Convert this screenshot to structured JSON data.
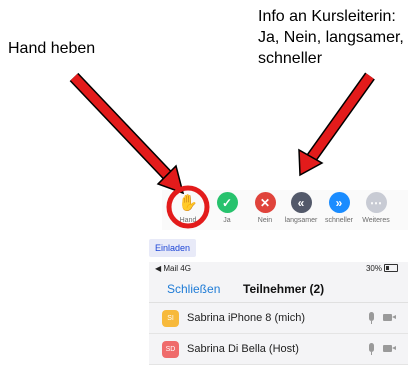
{
  "annotations": {
    "left_label": "Hand heben",
    "right_lines": [
      "Info an Kursleiterin:",
      "Ja, Nein, langsamer,",
      "schneller"
    ]
  },
  "colors": {
    "arrow": "#e31b1b",
    "accent_blue": "#1e7bd6",
    "raise_hand": "#2d8cff",
    "yes_green": "#27c26d",
    "no_red": "#e0433b",
    "slower_grey": "#53596a",
    "faster_blue": "#1a8cff",
    "more_grey": "#c8cbd4"
  },
  "reactions": [
    {
      "icon": "raise-hand-icon",
      "label": "Hand"
    },
    {
      "icon": "check-icon",
      "label": "Ja"
    },
    {
      "icon": "x-icon",
      "label": "Nein"
    },
    {
      "icon": "rewind-icon",
      "label": "langsamer"
    },
    {
      "icon": "fast-forward-icon",
      "label": "schneller"
    },
    {
      "icon": "ellipsis-icon",
      "label": "Weiteres"
    }
  ],
  "invite_label": "Einladen",
  "status_bar": {
    "left": "◀ Mail  4G",
    "right": "30%"
  },
  "nav": {
    "close_label": "Schließen",
    "title": "Teilnehmer (2)"
  },
  "participants": [
    {
      "initials": "SI",
      "name": "Sabrina iPhone 8 (mich)",
      "color": "#f7b93b"
    },
    {
      "initials": "SD",
      "name": "Sabrina Di Bella (Host)",
      "color": "#ef6b6b"
    }
  ]
}
